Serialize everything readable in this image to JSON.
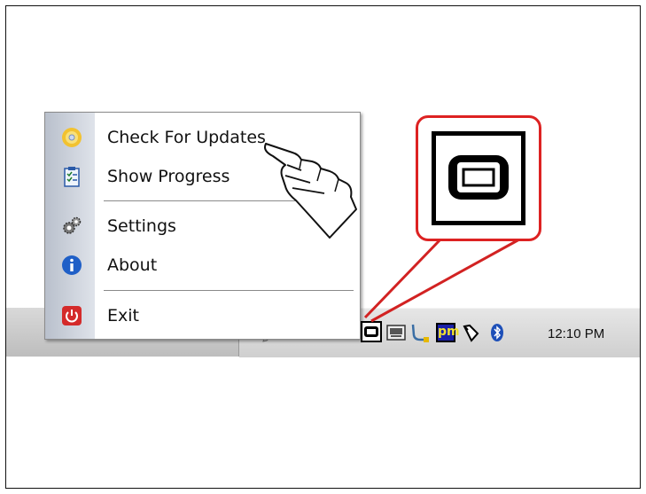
{
  "context_menu": {
    "items": [
      {
        "label": "Check For Updates",
        "icon": "update-disc-icon"
      },
      {
        "label": "Show Progress",
        "icon": "clipboard-progress-icon"
      },
      {
        "label": "Settings",
        "icon": "gears-icon"
      },
      {
        "label": "About",
        "icon": "info-icon"
      },
      {
        "label": "Exit",
        "icon": "power-icon"
      }
    ]
  },
  "system_tray": {
    "clock": "12:10 PM",
    "icons": [
      "pen-icon",
      "antivirus-icon",
      "updater-tray-icon",
      "keyboard-icon",
      "usb-cable-icon",
      "pm-icon",
      "mouse-icon",
      "bluetooth-icon"
    ],
    "pm_label": "pm"
  },
  "colors": {
    "callout": "#d22222",
    "taskbar": "#c8c8c8",
    "pm_badge": "#1a20a8"
  }
}
